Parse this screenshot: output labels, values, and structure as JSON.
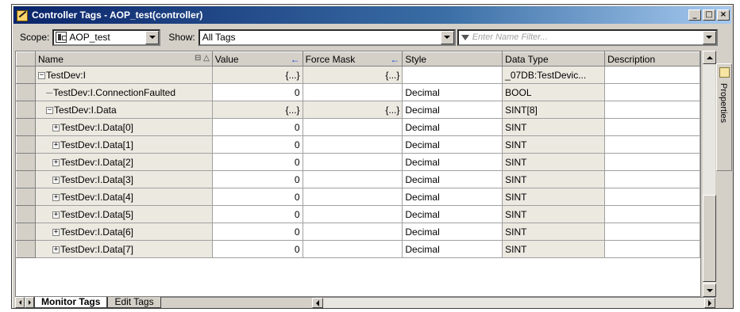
{
  "window": {
    "title": "Controller Tags - AOP_test(controller)",
    "buttons": {
      "minimize": "_",
      "maximize": "□",
      "close": "×"
    }
  },
  "toolbar": {
    "scope_label": "Scope:",
    "scope_value": "AOP_test",
    "show_label": "Show:",
    "show_value": "All Tags",
    "filter_placeholder": "Enter Name Filter..."
  },
  "columns": {
    "name": "Name",
    "value": "Value",
    "force_mask": "Force Mask",
    "style": "Style",
    "data_type": "Data Type",
    "description": "Description"
  },
  "rows": [
    {
      "name": "TestDev:I",
      "value": "{...}",
      "force": "{...}",
      "style": "",
      "type": "_07DB:TestDevic...",
      "desc": "",
      "tree": "minus",
      "indent": 0
    },
    {
      "name": "TestDev:I.ConnectionFaulted",
      "value": "0",
      "force": "",
      "style": "Decimal",
      "type": "BOOL",
      "desc": "",
      "tree": "line",
      "indent": 1
    },
    {
      "name": "TestDev:I.Data",
      "value": "{...}",
      "force": "{...}",
      "style": "Decimal",
      "type": "SINT[8]",
      "desc": "",
      "tree": "minus",
      "indent": 1
    },
    {
      "name": "TestDev:I.Data[0]",
      "value": "0",
      "force": "",
      "style": "Decimal",
      "type": "SINT",
      "desc": "",
      "tree": "plus",
      "indent": 2
    },
    {
      "name": "TestDev:I.Data[1]",
      "value": "0",
      "force": "",
      "style": "Decimal",
      "type": "SINT",
      "desc": "",
      "tree": "plus",
      "indent": 2
    },
    {
      "name": "TestDev:I.Data[2]",
      "value": "0",
      "force": "",
      "style": "Decimal",
      "type": "SINT",
      "desc": "",
      "tree": "plus",
      "indent": 2
    },
    {
      "name": "TestDev:I.Data[3]",
      "value": "0",
      "force": "",
      "style": "Decimal",
      "type": "SINT",
      "desc": "",
      "tree": "plus",
      "indent": 2
    },
    {
      "name": "TestDev:I.Data[4]",
      "value": "0",
      "force": "",
      "style": "Decimal",
      "type": "SINT",
      "desc": "",
      "tree": "plus",
      "indent": 2
    },
    {
      "name": "TestDev:I.Data[5]",
      "value": "0",
      "force": "",
      "style": "Decimal",
      "type": "SINT",
      "desc": "",
      "tree": "plus",
      "indent": 2
    },
    {
      "name": "TestDev:I.Data[6]",
      "value": "0",
      "force": "",
      "style": "Decimal",
      "type": "SINT",
      "desc": "",
      "tree": "plus",
      "indent": 2
    },
    {
      "name": "TestDev:I.Data[7]",
      "value": "0",
      "force": "",
      "style": "Decimal",
      "type": "SINT",
      "desc": "",
      "tree": "plus",
      "indent": 2
    }
  ],
  "tabs": {
    "monitor": "Monitor Tags",
    "edit": "Edit Tags"
  },
  "side_panel": {
    "label": "Properties"
  }
}
